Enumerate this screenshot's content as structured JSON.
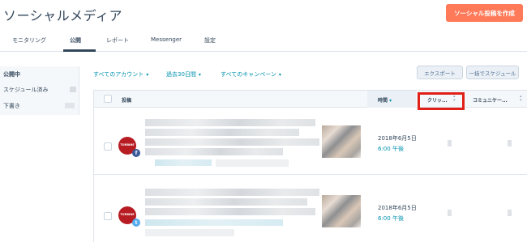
{
  "page": {
    "title": "ソーシャルメディア"
  },
  "header": {
    "create_label": "ソーシャル投稿を作成"
  },
  "tabs": [
    {
      "label": "モニタリング"
    },
    {
      "label": "公開"
    },
    {
      "label": "レポート"
    },
    {
      "label": "Messenger"
    },
    {
      "label": "設定"
    }
  ],
  "sidebar": {
    "items": [
      {
        "label": "公開中"
      },
      {
        "label": "スケジュール済み"
      },
      {
        "label": "下書き"
      }
    ]
  },
  "filters": {
    "accounts": "すべてのアカウント",
    "date_range": "過去30日間",
    "campaigns": "すべてのキャンペーン",
    "caret": "▾"
  },
  "actions": {
    "export_label": "エクスポート",
    "bulk_schedule_label": "一括でスケジュール"
  },
  "table": {
    "columns": {
      "post": "投稿",
      "time": "時間",
      "clicks": "クリッ...",
      "community": "コミュニケー..."
    },
    "time_sort_indicator": "▾",
    "rows": [
      {
        "date": "2018年6月5日",
        "time": "6:00 午後",
        "network": "facebook",
        "badge": "f",
        "avatar_text": "TURBINE"
      },
      {
        "date": "2018年6月5日",
        "time": "6:00 午後",
        "network": "twitter",
        "badge": "t",
        "avatar_text": "TURBINE"
      }
    ]
  },
  "colors": {
    "accent": "#ff7a59",
    "link": "#0091ae",
    "highlight": "#e02019",
    "facebook": "#3b5998",
    "twitter": "#55acee",
    "avatar": "#b81c23"
  }
}
